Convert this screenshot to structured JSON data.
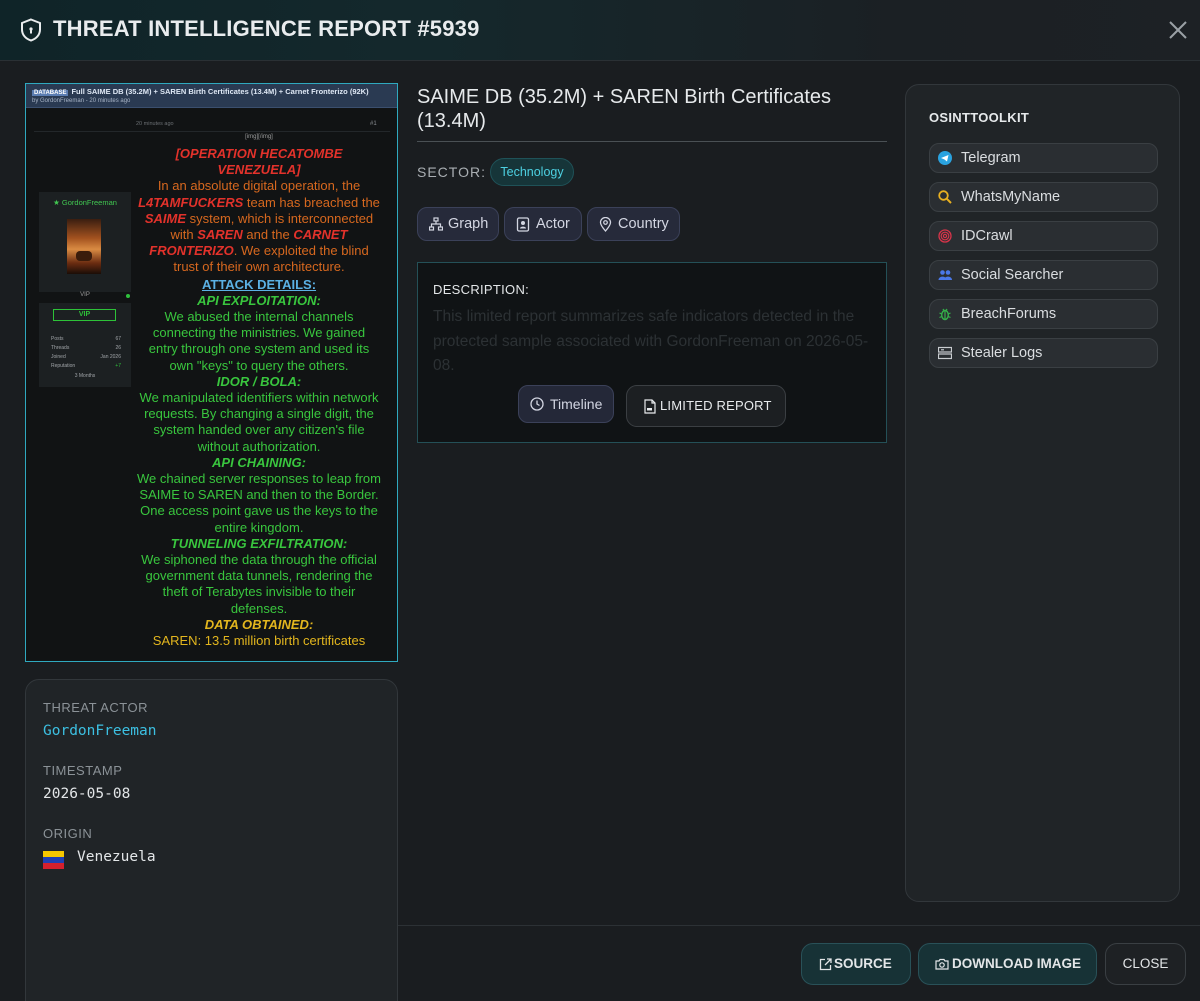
{
  "header": {
    "title": "THREAT INTELLIGENCE REPORT #5939",
    "icon": "shield-icon",
    "close_icon": "close-icon"
  },
  "forum_screenshot": {
    "tag": "DATABASE",
    "thread_title": "Full SAIME DB (35.2M) + SAREN Birth Certificates (13.4M) + Carnet Fronterizo (92K)",
    "thread_meta": "by GordonFreeman - 20 minutes ago",
    "post_time": "20 minutes ago",
    "post_number": "#1",
    "username": "GordonFreeman",
    "rank": "VIP",
    "badge": "VIP",
    "stats": [
      {
        "label": "Posts",
        "value": "67"
      },
      {
        "label": "Threads",
        "value": "26"
      },
      {
        "label": "Joined",
        "value": "Jan 2026"
      },
      {
        "label": "Reputation",
        "value": "+7"
      }
    ],
    "months": "3 Months",
    "img_tag": "[img][/img]",
    "heading": "[OPERATION HECATOMBE VENEZUELA]",
    "intro_1": "In an absolute digital operation, the",
    "intro_team": "L4TAMFUCKERS",
    "intro_2": "team has breached the",
    "intro_saime": "SAIME",
    "intro_3": "system, which is interconnected with",
    "intro_saren": "SAREN",
    "intro_4": "and the",
    "intro_carnet": "CARNET FRONTERIZO",
    "intro_5": ". We exploited the blind trust of their own architecture.",
    "attack_details": "ATTACK DETAILS:",
    "sections": [
      {
        "head": "API EXPLOITATION:",
        "text": "We abused the internal channels connecting the ministries. We gained entry through one system and used its own \"keys\" to query the others."
      },
      {
        "head": "IDOR / BOLA:",
        "text": "We manipulated identifiers within network requests. By changing a single digit, the system handed over any citizen's file without authorization."
      },
      {
        "head": "API CHAINING:",
        "text": "We chained server responses to leap from SAIME to SAREN and then to the Border. One access point gave us the keys to the entire kingdom."
      },
      {
        "head": "TUNNELING EXFILTRATION:",
        "text": "We siphoned the data through the official government data tunnels, rendering the theft of Terabytes invisible to their defenses."
      }
    ],
    "data_obtained": "DATA OBTAINED:",
    "data_cut": "SAREN: 13.5 million birth certificates"
  },
  "actor_card": {
    "threat_actor_label": "THREAT ACTOR",
    "threat_actor": "GordonFreeman",
    "timestamp_label": "TIMESTAMP",
    "timestamp": "2026-05-08",
    "origin_label": "ORIGIN",
    "origin": "Venezuela",
    "flag_icon": "venezuela-flag-icon"
  },
  "report": {
    "title": "SAIME DB (35.2M) + SAREN Birth Certificates (13.4M)",
    "sector_label": "SECTOR:",
    "sector": "Technology",
    "chips": [
      {
        "label": "Graph",
        "icon": "graph-icon"
      },
      {
        "label": "Actor",
        "icon": "actor-icon"
      },
      {
        "label": "Country",
        "icon": "location-pin-icon"
      }
    ],
    "description_label": "DESCRIPTION:",
    "description": "This limited report summarizes safe indicators detected in the protected sample associated with GordonFreeman on 2026-05-08.",
    "timeline_label": "Timeline",
    "limited_label": "LIMITED REPORT"
  },
  "toolkit": {
    "title": "OSINTTOOLKIT",
    "items": [
      {
        "label": "Telegram",
        "icon": "telegram-icon",
        "color": "#2aa3e0"
      },
      {
        "label": "WhatsMyName",
        "icon": "search-icon",
        "color": "#e8b021"
      },
      {
        "label": "IDCrawl",
        "icon": "fingerprint-icon",
        "color": "#d8344a"
      },
      {
        "label": "Social Searcher",
        "icon": "users-icon",
        "color": "#4a78e8"
      },
      {
        "label": "BreachForums",
        "icon": "bug-icon",
        "color": "#35b04a"
      },
      {
        "label": "Stealer Logs",
        "icon": "terminal-icon",
        "color": "#c9ccd0"
      }
    ]
  },
  "footer": {
    "source_label": "SOURCE",
    "download_label": "DOWNLOAD IMAGE",
    "close_label": "CLOSE"
  },
  "colors": {
    "accent_teal": "#3cc0e2",
    "border_teal": "#2fa9bf",
    "background": "#1a1d20"
  }
}
